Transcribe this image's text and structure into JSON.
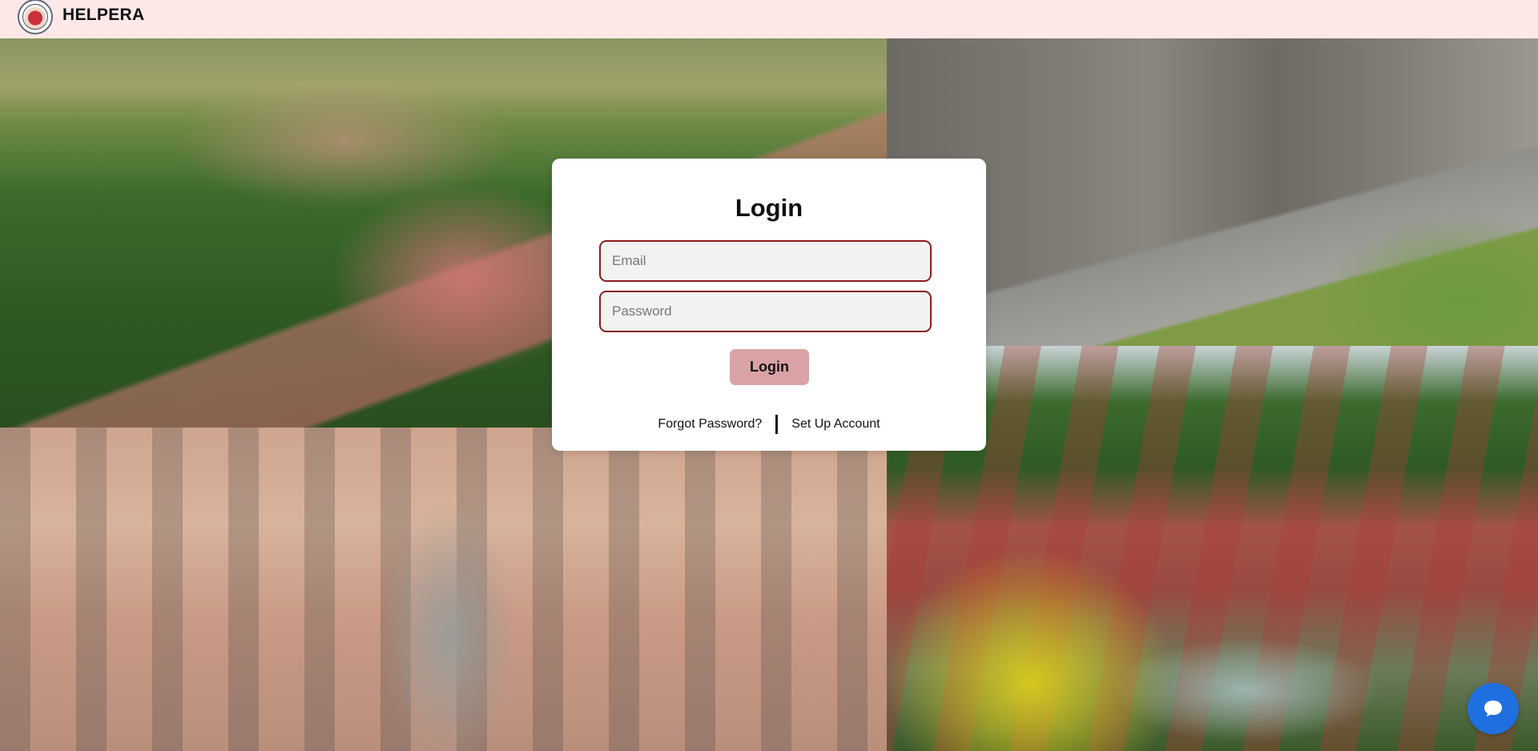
{
  "header": {
    "brand": "HELPERA",
    "logo_icon": "helpera-logo-icon"
  },
  "login_card": {
    "title": "Login",
    "email": {
      "value": "",
      "placeholder": "Email"
    },
    "password": {
      "value": "",
      "placeholder": "Password"
    },
    "submit_label": "Login",
    "forgot_password_label": "Forgot Password?",
    "setup_account_label": "Set Up Account"
  },
  "chat_widget": {
    "icon": "chat-bubble-icon"
  },
  "colors": {
    "header_bg": "#fde8e8",
    "input_border": "#8b1c1c",
    "input_bg": "#f2f2f2",
    "button_bg": "#d9a3a5",
    "chat_bg": "#1f6fe0"
  }
}
